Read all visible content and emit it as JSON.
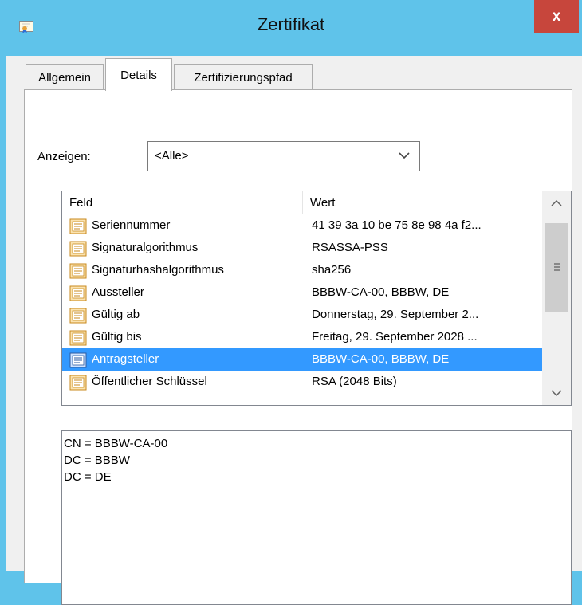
{
  "window": {
    "title": "Zertifikat",
    "close_label": "x",
    "icon": "certificate-icon"
  },
  "tabs": [
    {
      "label": "Allgemein",
      "active": false
    },
    {
      "label": "Details",
      "active": true
    },
    {
      "label": "Zertifizierungspfad",
      "active": false
    }
  ],
  "show": {
    "label": "Anzeigen:",
    "selected": "<Alle>"
  },
  "list": {
    "columns": [
      "Feld",
      "Wert"
    ],
    "rows": [
      {
        "field": "Seriennummer",
        "value": "41 39 3a 10 be 75 8e 98 4a f2..."
      },
      {
        "field": "Signaturalgorithmus",
        "value": "RSASSA-PSS"
      },
      {
        "field": "Signaturhashalgorithmus",
        "value": "sha256"
      },
      {
        "field": "Aussteller",
        "value": "BBBW-CA-00, BBBW, DE"
      },
      {
        "field": "Gültig ab",
        "value": "Donnerstag, 29. September 2..."
      },
      {
        "field": "Gültig bis",
        "value": "Freitag, 29. September 2028 ..."
      },
      {
        "field": "Antragsteller",
        "value": "BBBW-CA-00, BBBW, DE",
        "selected": true
      },
      {
        "field": "Öffentlicher Schlüssel",
        "value": "RSA (2048 Bits)"
      }
    ]
  },
  "detail": {
    "lines": [
      "CN = BBBW-CA-00",
      "DC = BBBW",
      "DC = DE"
    ]
  },
  "colors": {
    "titlebar": "#5fc3ea",
    "close_button": "#c7463c",
    "selection": "#3399ff"
  }
}
